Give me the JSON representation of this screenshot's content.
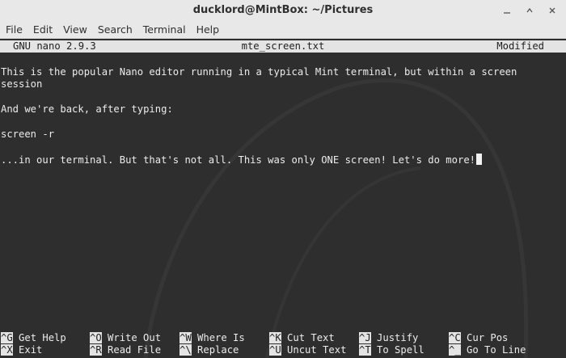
{
  "window": {
    "title": "ducklord@MintBox: ~/Pictures"
  },
  "menu": {
    "items": [
      "File",
      "Edit",
      "View",
      "Search",
      "Terminal",
      "Help"
    ]
  },
  "nano": {
    "version": "GNU nano 2.9.3",
    "filename": "mte_screen.txt",
    "status": "Modified"
  },
  "content": {
    "lines": [
      "This is the popular Nano editor running in a typical Mint terminal, but within a screen",
      "session",
      "And we're back, after typing:",
      "screen -r",
      "...in our terminal. But that's not all. This was only ONE screen! Let's do more!"
    ]
  },
  "shortcuts": [
    {
      "key": "^G",
      "label": "Get Help"
    },
    {
      "key": "^O",
      "label": "Write Out"
    },
    {
      "key": "^W",
      "label": "Where Is"
    },
    {
      "key": "^K",
      "label": "Cut Text"
    },
    {
      "key": "^J",
      "label": "Justify"
    },
    {
      "key": "^C",
      "label": "Cur Pos"
    },
    {
      "key": "^X",
      "label": "Exit"
    },
    {
      "key": "^R",
      "label": "Read File"
    },
    {
      "key": "^\\",
      "label": "Replace"
    },
    {
      "key": "^U",
      "label": "Uncut Text"
    },
    {
      "key": "^T",
      "label": "To Spell"
    },
    {
      "key": "^_",
      "label": "Go To Line"
    }
  ],
  "icons": {
    "minimize": "minimize-icon",
    "maximize": "maximize-icon",
    "close": "close-icon"
  },
  "colors": {
    "terminal_bg": "#2e2e2e",
    "terminal_fg": "#ececec",
    "chrome_bg": "#e8e8e8",
    "highlight_bg": "#e4e4e4"
  }
}
